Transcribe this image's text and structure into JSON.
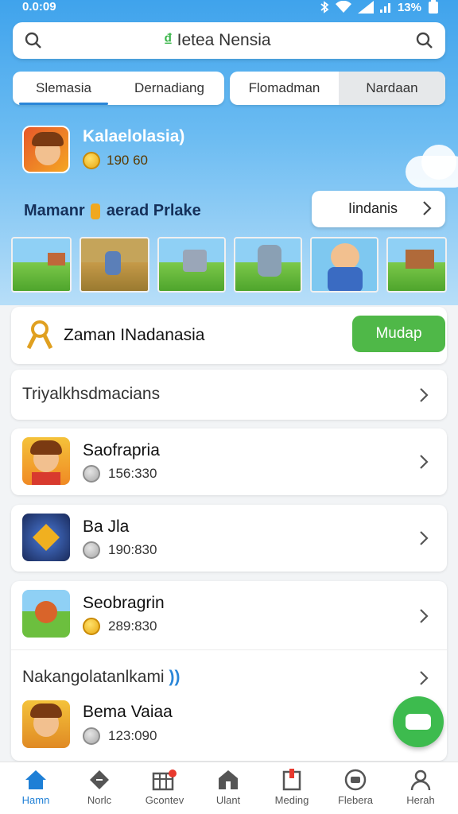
{
  "status_bar": {
    "time": "0.0:09",
    "battery": "13%"
  },
  "search": {
    "text": "Ietea Nensia",
    "brand": "₫"
  },
  "tabs": [
    {
      "label": "Slemasia",
      "active": true
    },
    {
      "label": "Dernadiang",
      "active": false
    },
    {
      "label": "Flomadman",
      "active": false
    },
    {
      "label": "Nardaan",
      "active": false
    }
  ],
  "game": {
    "title": "Kalaelolasia)",
    "coins": "190 60"
  },
  "banner": {
    "title_part1": "Mamanr",
    "title_part2": "aerad Prlake",
    "button_label": "Iindanis"
  },
  "promo": {
    "label": "Zaman INadanasia",
    "button_label": "Mudap"
  },
  "category": {
    "label": "Triyalkhsdmacians"
  },
  "list": [
    {
      "title": "Saofrapria",
      "score": "156:330",
      "coin": "grey"
    },
    {
      "title": "Ba Jla",
      "score": "190:830",
      "coin": "grey"
    },
    {
      "title": "Seobragrin",
      "score": "289:830",
      "coin": "gold"
    }
  ],
  "section": {
    "title": "Nakangolatanlkami"
  },
  "last_item": {
    "title": "Bema Vaiaa",
    "score": "123:090",
    "coin": "grey"
  },
  "nav": [
    {
      "label": "Hamn",
      "icon": "home-icon",
      "active": true
    },
    {
      "label": "Norlc",
      "icon": "diamond-icon",
      "active": false
    },
    {
      "label": "Gcontev",
      "icon": "grid-icon",
      "active": false
    },
    {
      "label": "Ulant",
      "icon": "house-icon",
      "active": false
    },
    {
      "label": "Meding",
      "icon": "flag-icon",
      "active": false
    },
    {
      "label": "Flebera",
      "icon": "message-icon",
      "active": false
    },
    {
      "label": "Herah",
      "icon": "person-icon",
      "active": false
    }
  ],
  "colors": {
    "accent": "#1e7fd6",
    "green": "#4fb848",
    "sky": "#3fa3ec"
  }
}
